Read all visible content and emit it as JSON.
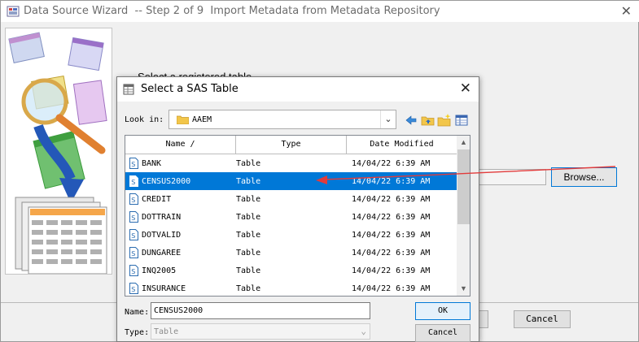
{
  "wizard": {
    "title": "Data Source Wizard  -- Step 2 of 9  Import Metadata from Metadata Repository",
    "prompt": "Select a registered table",
    "browse_label": "Browse...",
    "cancel_label": "Cancel"
  },
  "dialog": {
    "title": "Select a SAS Table",
    "look_in_label": "Look in:",
    "look_in_value": "AAEM",
    "columns": [
      "Name /",
      "Type",
      "Date Modified"
    ],
    "rows": [
      {
        "name": "BANK",
        "type": "Table",
        "date": "14/04/22 6:39 AM",
        "selected": false
      },
      {
        "name": "CENSUS2000",
        "type": "Table",
        "date": "14/04/22 6:39 AM",
        "selected": true
      },
      {
        "name": "CREDIT",
        "type": "Table",
        "date": "14/04/22 6:39 AM",
        "selected": false
      },
      {
        "name": "DOTTRAIN",
        "type": "Table",
        "date": "14/04/22 6:39 AM",
        "selected": false
      },
      {
        "name": "DOTVALID",
        "type": "Table",
        "date": "14/04/22 6:39 AM",
        "selected": false
      },
      {
        "name": "DUNGAREE",
        "type": "Table",
        "date": "14/04/22 6:39 AM",
        "selected": false
      },
      {
        "name": "INQ2005",
        "type": "Table",
        "date": "14/04/22 6:39 AM",
        "selected": false
      },
      {
        "name": "INSURANCE",
        "type": "Table",
        "date": "14/04/22 6:39 AM",
        "selected": false
      }
    ],
    "name_label": "Name:",
    "name_value": "CENSUS2000",
    "type_label": "Type:",
    "type_value": "Table",
    "ok_label": "OK",
    "cancel_label": "Cancel"
  },
  "colors": {
    "selection": "#0078d7",
    "annotation_arrow": "#e23b3b"
  }
}
